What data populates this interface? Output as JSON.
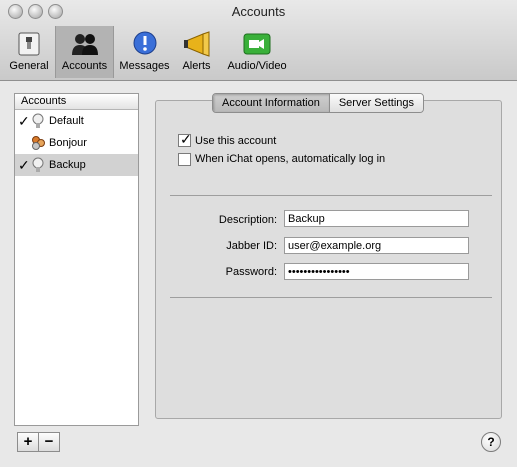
{
  "window": {
    "title": "Accounts"
  },
  "toolbar": {
    "items": [
      {
        "label": "General",
        "icon": "switch-icon"
      },
      {
        "label": "Accounts",
        "icon": "people-icon"
      },
      {
        "label": "Messages",
        "icon": "speech-bubble-icon"
      },
      {
        "label": "Alerts",
        "icon": "megaphone-icon"
      },
      {
        "label": "Audio/Video",
        "icon": "video-camera-icon"
      }
    ],
    "selected": "Accounts"
  },
  "accounts": {
    "header": "Accounts",
    "items": [
      {
        "name": "Default",
        "checked": true,
        "icon": "lightbulb-icon"
      },
      {
        "name": "Bonjour",
        "checked": false,
        "icon": "bonjour-icon"
      },
      {
        "name": "Backup",
        "checked": true,
        "icon": "lightbulb-icon",
        "selected": true
      }
    ],
    "add_label": "+",
    "remove_label": "−"
  },
  "tabs": {
    "items": [
      "Account Information",
      "Server Settings"
    ],
    "active": "Account Information"
  },
  "options": {
    "use_account": {
      "label": "Use this account",
      "checked": true
    },
    "auto_login": {
      "label": "When iChat opens, automatically log in",
      "checked": false
    }
  },
  "form": {
    "description": {
      "label": "Description:",
      "value": "Backup"
    },
    "jabber_id": {
      "label": "Jabber ID:",
      "value": "user@example.org"
    },
    "password": {
      "label": "Password:",
      "value": "••••••••••••••••"
    }
  },
  "help": {
    "label": "?"
  },
  "colors": {
    "checkmark": "#000000",
    "selected_row": "#d2d2d2"
  }
}
